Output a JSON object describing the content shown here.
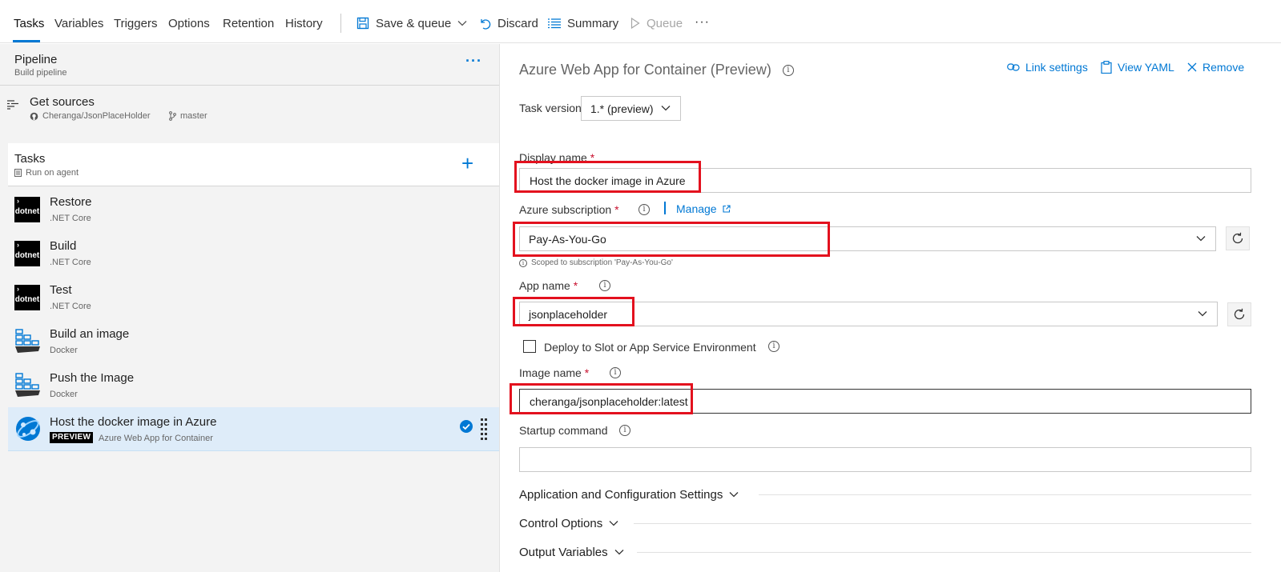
{
  "toolbar": {
    "tabs": [
      "Tasks",
      "Variables",
      "Triggers",
      "Options",
      "Retention",
      "History"
    ],
    "save_queue": "Save & queue",
    "discard": "Discard",
    "summary": "Summary",
    "queue": "Queue",
    "more": "···"
  },
  "pipeline": {
    "title": "Pipeline",
    "subtitle": "Build pipeline",
    "more": "···"
  },
  "get_sources": {
    "title": "Get sources",
    "repo": "Cheranga/JsonPlaceHolder",
    "branch": "master"
  },
  "tasks_section": {
    "title": "Tasks",
    "subtitle": "Run on agent"
  },
  "tasks": [
    {
      "name": "Restore",
      "type": ".NET Core",
      "icon": "dotnet-icon"
    },
    {
      "name": "Build",
      "type": ".NET Core",
      "icon": "dotnet-icon"
    },
    {
      "name": "Test",
      "type": ".NET Core",
      "icon": "dotnet-icon"
    },
    {
      "name": "Build an image",
      "type": "Docker",
      "icon": "docker-icon"
    },
    {
      "name": "Push the Image",
      "type": "Docker",
      "icon": "docker-icon"
    },
    {
      "name": "Host the docker image in Azure",
      "type": "Azure Web App for Container",
      "badge": "PREVIEW",
      "icon": "azure-web-app-icon",
      "selected": true
    }
  ],
  "dotnet_icon_text": "dotnet",
  "detail": {
    "title": "Azure Web App for Container (Preview)",
    "link_settings": "Link settings",
    "view_yaml": "View YAML",
    "remove": "Remove",
    "task_version_label": "Task version",
    "task_version_value": "1.* (preview)",
    "display_name_label": "Display name",
    "display_name_value": "Host the docker image in Azure",
    "subscription_label": "Azure subscription",
    "manage": "Manage",
    "subscription_value": "Pay-As-You-Go",
    "subscription_hint": "Scoped to subscription 'Pay-As-You-Go'",
    "app_name_label": "App name",
    "app_name_value": "jsonplaceholder",
    "deploy_slot_label": "Deploy to Slot or App Service Environment",
    "deploy_slot_checked": false,
    "image_name_label": "Image name",
    "image_name_value": "cheranga/jsonplaceholder:latest",
    "startup_label": "Startup command",
    "startup_value": "",
    "sections": [
      "Application and Configuration Settings",
      "Control Options",
      "Output Variables"
    ]
  },
  "required_marker": "*",
  "colors": {
    "accent": "#0078d4",
    "highlight_box": "#e3111e",
    "selected_row": "#deecf9"
  }
}
